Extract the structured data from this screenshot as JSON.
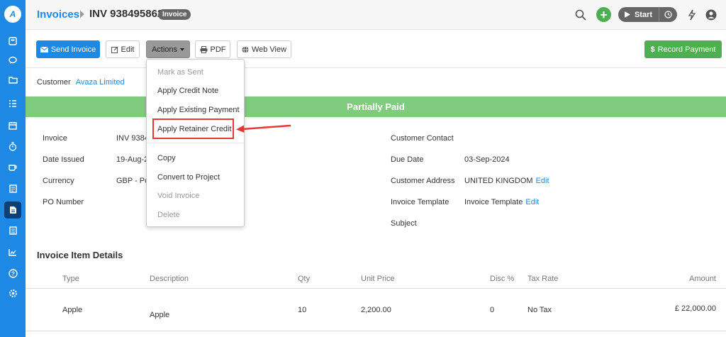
{
  "sidebar": {
    "logo_icon": "avaza-logo-icon",
    "items": [
      {
        "name": "dashboard-icon"
      },
      {
        "name": "chat-icon"
      },
      {
        "name": "folder-icon"
      },
      {
        "name": "task-list-icon"
      },
      {
        "name": "calendar-icon"
      },
      {
        "name": "timer-icon"
      },
      {
        "name": "coffee-icon"
      },
      {
        "name": "document-icon"
      },
      {
        "name": "invoice-icon",
        "active": true
      },
      {
        "name": "report-icon"
      },
      {
        "name": "chart-icon"
      },
      {
        "name": "help-icon"
      },
      {
        "name": "settings-icon"
      }
    ]
  },
  "header": {
    "breadcrumb_link": "Invoices",
    "title": "INV 938495862",
    "badge": "Invoice",
    "timer_label": "Start"
  },
  "toolbar": {
    "send_label": "Send Invoice",
    "edit_label": "Edit",
    "actions_label": "Actions",
    "pdf_label": "PDF",
    "webview_label": "Web View",
    "record_payment_label": "Record Payment"
  },
  "customer": {
    "label": "Customer",
    "name": "Avaza Limited"
  },
  "status": "Partially Paid",
  "details_left": [
    {
      "label": "Invoice",
      "value": "INV 9384"
    },
    {
      "label": "Date Issued",
      "value": "19-Aug-2("
    },
    {
      "label": "Currency",
      "value": "GBP - Pou"
    },
    {
      "label": "PO Number",
      "value": ""
    }
  ],
  "details_right": {
    "contact_label": "Customer Contact",
    "due_label": "Due Date",
    "due_value": "03-Sep-2024",
    "address_label": "Customer Address",
    "address_value": "UNITED KINGDOM",
    "template_label": "Invoice Template",
    "template_value": "Invoice Template",
    "subject_label": "Subject",
    "edit_label": "Edit"
  },
  "items_section": {
    "title": "Invoice Item Details",
    "columns": {
      "type": "Type",
      "description": "Description",
      "qty": "Qty",
      "unit_price": "Unit Price",
      "disc": "Disc %",
      "tax": "Tax Rate",
      "amount": "Amount"
    },
    "rows": [
      {
        "type": "Apple",
        "description": "Apple",
        "qty": "10",
        "unit_price": "2,200.00",
        "disc": "0",
        "tax": "No Tax",
        "amount": "£ 22,000.00"
      }
    ]
  },
  "actions_menu": {
    "items": [
      {
        "label": "Mark as Sent",
        "disabled": true
      },
      {
        "label": "Apply Credit Note",
        "disabled": false
      },
      {
        "label": "Apply Existing Payment",
        "disabled": false
      },
      {
        "label": "Apply Retainer Credit",
        "disabled": false,
        "highlighted": true
      },
      {
        "label": "Copy",
        "disabled": false
      },
      {
        "label": "Convert to Project",
        "disabled": false
      },
      {
        "label": "Void Invoice",
        "disabled": true
      },
      {
        "label": "Delete",
        "disabled": true
      }
    ]
  },
  "colors": {
    "primary": "#1e88e5",
    "success": "#4caf50",
    "status_banner": "#80cc7f",
    "annotation": "#e53935"
  }
}
